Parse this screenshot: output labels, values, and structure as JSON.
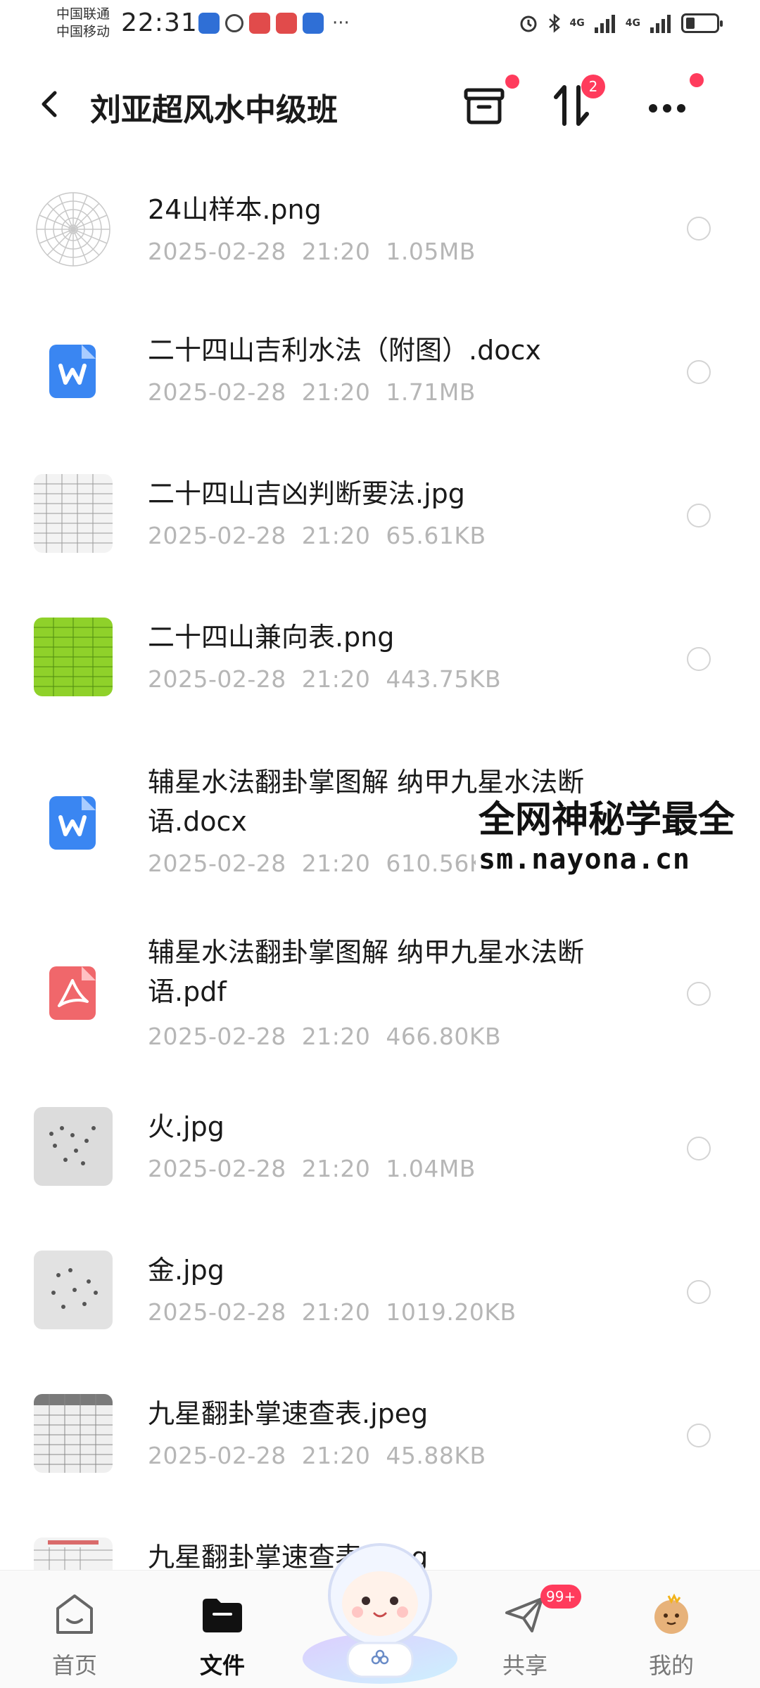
{
  "status_bar": {
    "carrier1": "中国联通",
    "carrier2": "中国移动",
    "time": "22:31",
    "net1": "4G",
    "net2": "4G",
    "more": "···"
  },
  "header": {
    "title": "刘亚超风水中级班",
    "sort_badge": "2"
  },
  "files": [
    {
      "name": "24山样本.png",
      "date": "2025-02-28",
      "time": "21:20",
      "size": "1.05MB",
      "icon": "compass-thumbnail"
    },
    {
      "name": "二十四山吉利水法（附图）.docx",
      "date": "2025-02-28",
      "time": "21:20",
      "size": "1.71MB",
      "icon": "word-icon"
    },
    {
      "name": "二十四山吉凶判断要法.jpg",
      "date": "2025-02-28",
      "time": "21:20",
      "size": "65.61KB",
      "icon": "table-thumbnail"
    },
    {
      "name": "二十四山兼向表.png",
      "date": "2025-02-28",
      "time": "21:20",
      "size": "443.75KB",
      "icon": "green-table-thumbnail"
    },
    {
      "name": "辅星水法翻卦掌图解 纳甲九星水法断语.docx",
      "date": "2025-02-28",
      "time": "21:20",
      "size": "610.56KB",
      "icon": "word-icon"
    },
    {
      "name": "辅星水法翻卦掌图解 纳甲九星水法断语.pdf",
      "date": "2025-02-28",
      "time": "21:20",
      "size": "466.80KB",
      "icon": "pdf-icon"
    },
    {
      "name": "火.jpg",
      "date": "2025-02-28",
      "time": "21:20",
      "size": "1.04MB",
      "icon": "photo-thumbnail"
    },
    {
      "name": "金.jpg",
      "date": "2025-02-28",
      "time": "21:20",
      "size": "1019.20KB",
      "icon": "photo-thumbnail"
    },
    {
      "name": "九星翻卦掌速查表.jpeg",
      "date": "2025-02-28",
      "time": "21:20",
      "size": "45.88KB",
      "icon": "table-thumbnail"
    },
    {
      "name": "九星翻卦掌速查表.jpeg",
      "date": "",
      "time": "",
      "size": "",
      "icon": "table-thumbnail"
    }
  ],
  "watermark": {
    "line1": "全网神秘学最全",
    "line2": "sm.nayona.cn"
  },
  "bottom_nav": {
    "home": "首页",
    "files": "文件",
    "share": "共享",
    "share_badge": "99+",
    "mine": "我的"
  },
  "colors": {
    "accent_red": "#ff3b5c",
    "word_blue": "#3a86f2",
    "pdf_red": "#f0676b",
    "meta_gray": "#b6b6b6"
  }
}
